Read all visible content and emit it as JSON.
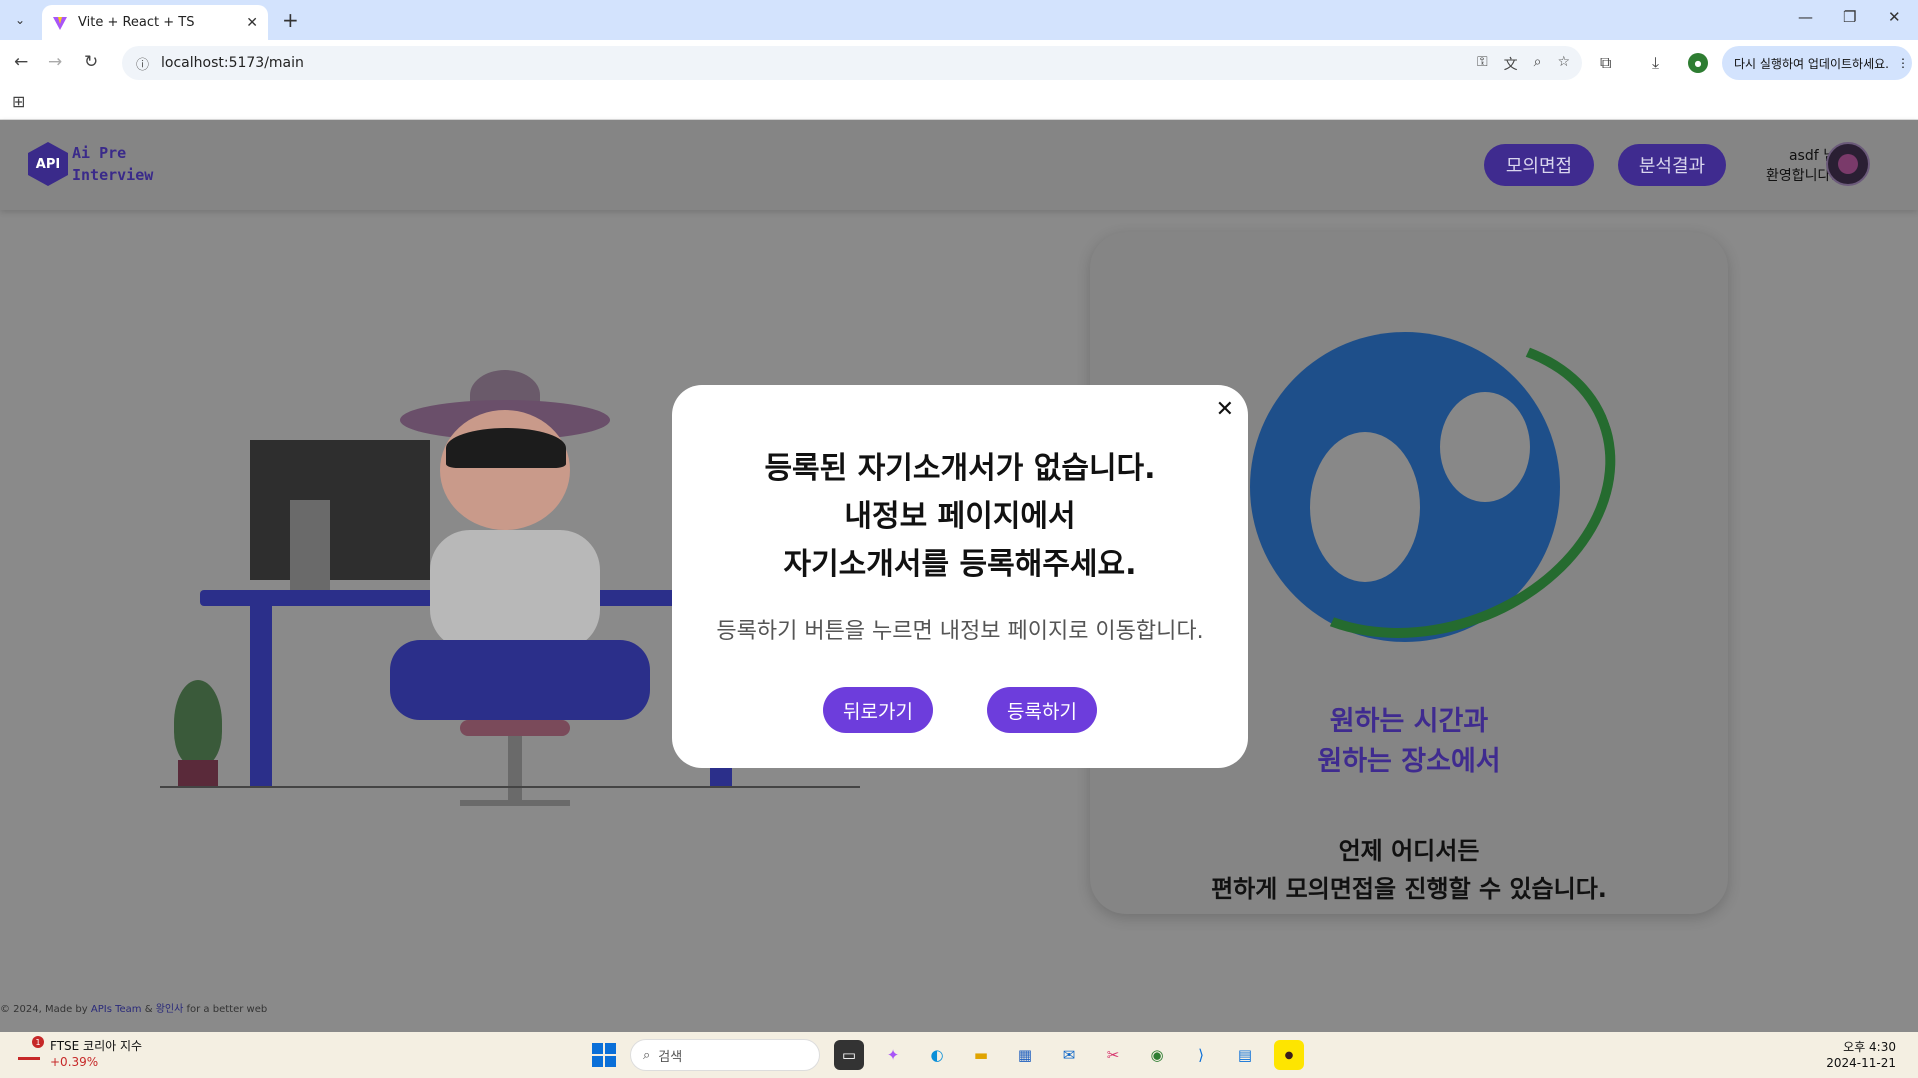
{
  "browser": {
    "tab_title": "Vite + React + TS",
    "url": "localhost:5173/main",
    "update_label": "다시 실행하여 업데이트하세요."
  },
  "app": {
    "logo": {
      "mark": "API",
      "line1": "Ai Pre",
      "line2": "Interview"
    },
    "nav": {
      "interview": "모의면접",
      "results": "분석결과"
    },
    "user": {
      "name": "asdf 님",
      "greeting": "환영합니다!"
    },
    "card": {
      "purple_line1": "원하는 시간과",
      "purple_line2": "원하는 장소에서",
      "black_line1": "언제 어디서든",
      "black_line2": "편하게 모의면접을 진행할 수 있습니다."
    },
    "footer": {
      "prefix": "© 2024, Made by",
      "team": "APIs Team",
      "amp": "&",
      "member": "왕인사",
      "suffix": "for a better web"
    }
  },
  "modal": {
    "title_line1": "등록된 자기소개서가 없습니다.",
    "title_line2": "내정보 페이지에서",
    "title_line3": "자기소개서를 등록해주세요.",
    "subtitle": "등록하기 버튼을 누르면 내정보 페이지로 이동합니다.",
    "back_label": "뒤로가기",
    "register_label": "등록하기",
    "close_symbol": "✕"
  },
  "taskbar": {
    "stock_name": "FTSE 코리아 지수",
    "stock_change": "+0.39%",
    "stock_badge": "1",
    "search_placeholder": "검색",
    "time": "오후 4:30",
    "date": "2024-11-21"
  },
  "colors": {
    "accent": "#6d3ddc",
    "header_btn": "#3f2b8f",
    "overlay": "#8a8a8a"
  }
}
